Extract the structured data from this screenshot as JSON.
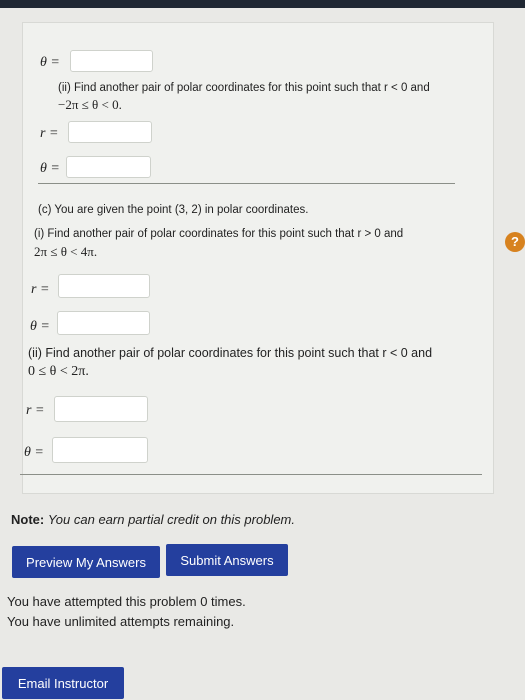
{
  "part_b_ii": {
    "theta_symbol": "θ =",
    "prompt": "(ii) Find another pair of polar coordinates for this point such that r < 0 and",
    "condition": "−2π ≤ θ < 0.",
    "r_label": "r =",
    "theta_label": "θ ="
  },
  "part_c": {
    "heading": "(c) You are given the point (3, 2) in polar coordinates.",
    "i_prompt": "(i) Find another pair of polar coordinates for this point such that r > 0 and",
    "i_condition": "2π ≤ θ < 4π.",
    "r_label": "r =",
    "theta_label": "θ =",
    "ii_prompt": "(ii) Find another pair of polar coordinates for this point such that r < 0 and",
    "ii_condition": "0 ≤ θ < 2π.",
    "ii_r_label": "r =",
    "ii_theta_label": "θ ="
  },
  "note": {
    "bold": "Note:",
    "text": "You can earn partial credit on this problem."
  },
  "buttons": {
    "preview": "Preview My Answers",
    "submit": "Submit Answers",
    "email": "Email Instructor"
  },
  "status": {
    "attempted": "You have attempted this problem 0 times.",
    "remaining": "You have unlimited attempts remaining."
  },
  "help_icon": "?",
  "colors": {
    "button": "#243f9e",
    "help": "#d7821f"
  }
}
